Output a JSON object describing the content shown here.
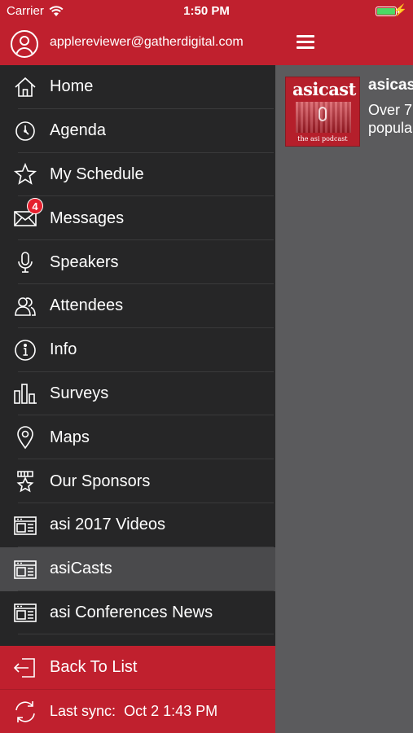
{
  "status_bar": {
    "carrier": "Carrier",
    "time": "1:50 PM"
  },
  "user": {
    "email": "applereviewer@gatherdigital.com"
  },
  "menu": {
    "items": [
      {
        "label": "Home",
        "icon": "home-icon"
      },
      {
        "label": "Agenda",
        "icon": "clock-icon"
      },
      {
        "label": "My Schedule",
        "icon": "star-icon"
      },
      {
        "label": "Messages",
        "icon": "envelope-icon",
        "badge": "4"
      },
      {
        "label": "Speakers",
        "icon": "microphone-icon"
      },
      {
        "label": "Attendees",
        "icon": "people-icon"
      },
      {
        "label": "Info",
        "icon": "info-icon"
      },
      {
        "label": "Surveys",
        "icon": "bar-chart-icon"
      },
      {
        "label": "Maps",
        "icon": "map-pin-icon"
      },
      {
        "label": "Our Sponsors",
        "icon": "award-icon"
      },
      {
        "label": "asi 2017 Videos",
        "icon": "browser-icon"
      },
      {
        "label": "asiCasts",
        "icon": "browser-icon",
        "active": true
      },
      {
        "label": "asi Conferences News",
        "icon": "browser-icon"
      }
    ]
  },
  "footer": {
    "back_label": "Back To List",
    "sync_label": "Last sync:",
    "sync_time": "Oct 2 1:43 PM"
  },
  "content": {
    "thumb_title": "asicast",
    "thumb_subtitle": "the asi podcast",
    "item_title": "asicas",
    "item_desc_line1": "Over 7",
    "item_desc_line2": "popula"
  },
  "colors": {
    "brand_red": "#c0202e",
    "drawer_bg": "#262627",
    "active_bg": "#4a4a4c",
    "pane_bg": "#5b5b5d"
  }
}
